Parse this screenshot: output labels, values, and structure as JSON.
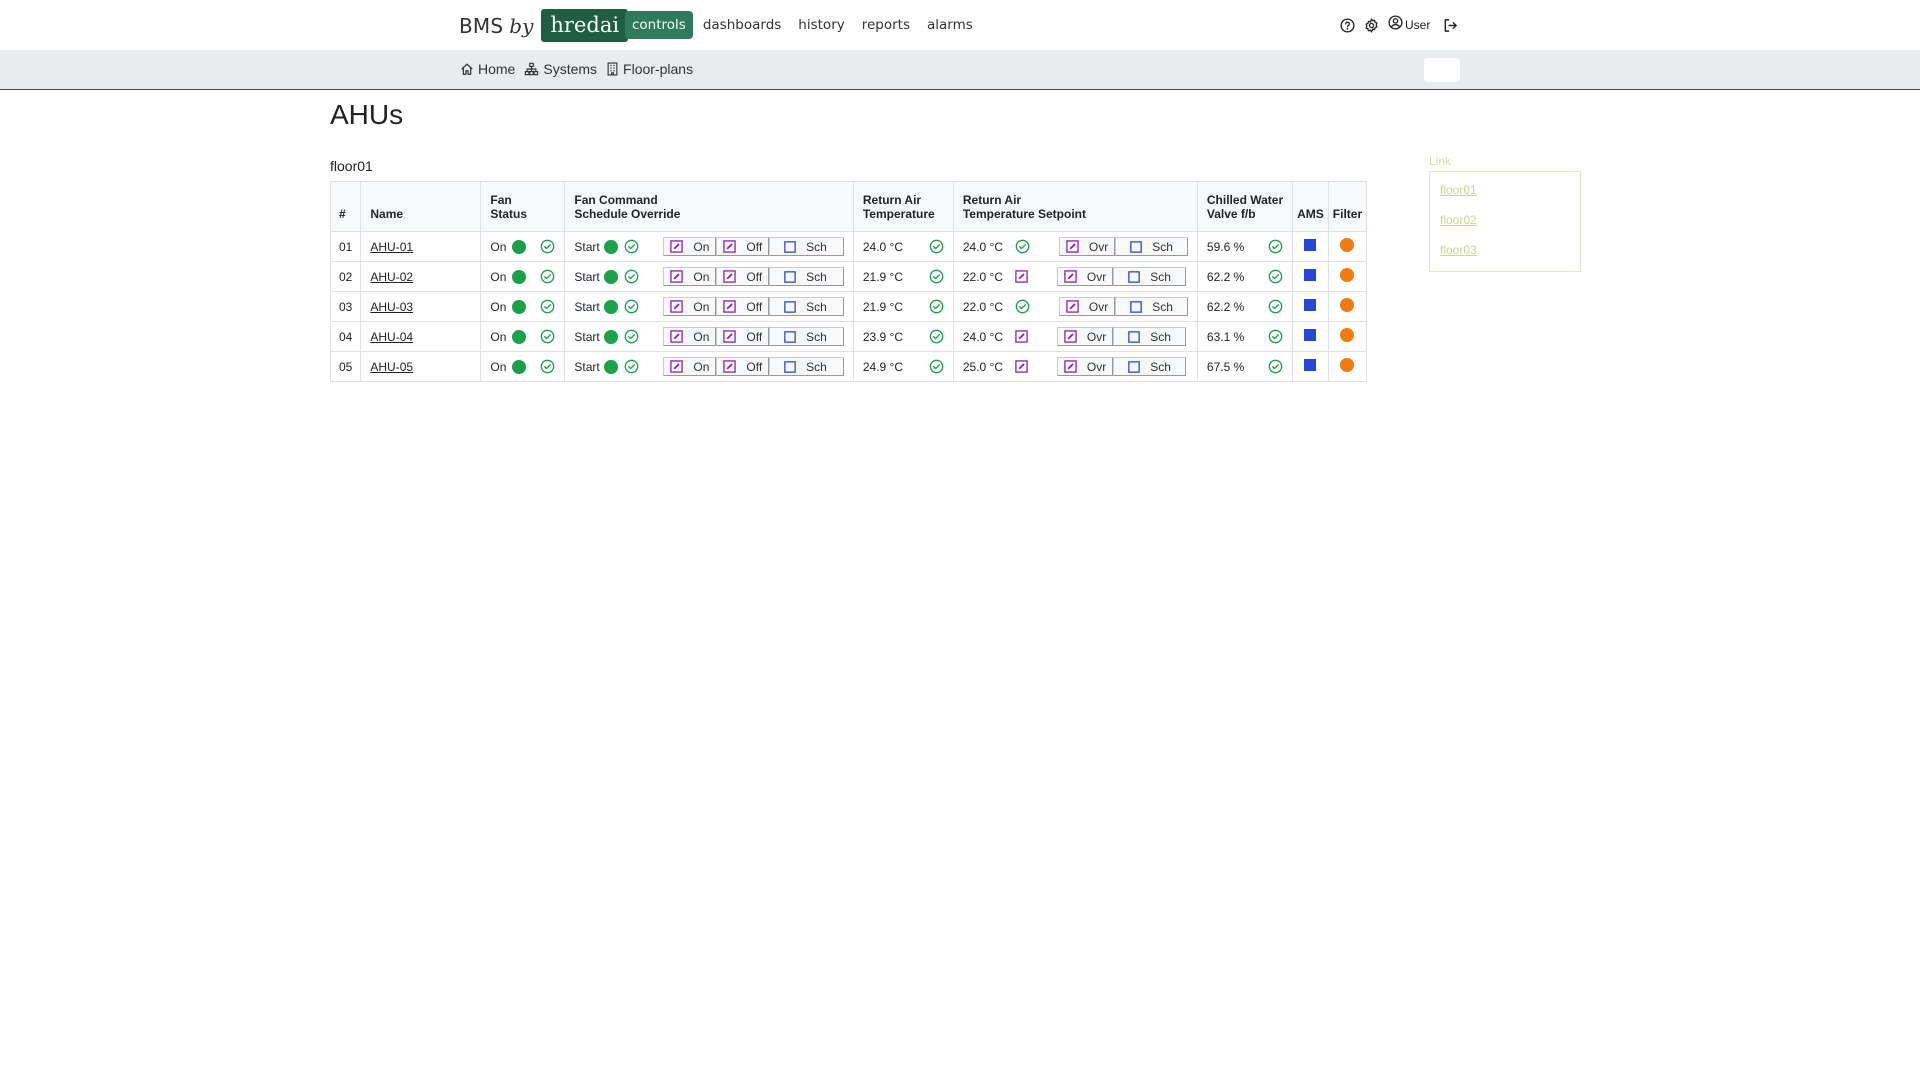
{
  "brand": {
    "bms": "BMS",
    "by": "by",
    "logo": "hredai"
  },
  "nav": {
    "items": [
      {
        "label": "controls",
        "active": true
      },
      {
        "label": "dashboards",
        "active": false
      },
      {
        "label": "history",
        "active": false
      },
      {
        "label": "reports",
        "active": false
      },
      {
        "label": "alarms",
        "active": false
      }
    ],
    "user_label": "User",
    "icons": [
      "help-icon",
      "settings-icon",
      "user-circle-icon",
      "logout-icon"
    ]
  },
  "subnav": {
    "items": [
      {
        "label": "Home",
        "icon": "home-icon"
      },
      {
        "label": "Systems",
        "icon": "sitemap-icon"
      },
      {
        "label": "Floor-plans",
        "icon": "building-icon"
      }
    ]
  },
  "page": {
    "title": "AHUs",
    "section": "floor01"
  },
  "table": {
    "headers": {
      "num": "#",
      "name": "Name",
      "fan_status_1": "Fan",
      "fan_status_2": "Status",
      "fan_cmd_1": "Fan Command",
      "fan_cmd_2": "Schedule Override",
      "rat_1": "Return Air",
      "rat_2": "Temperature",
      "rats_1": "Return Air",
      "rats_2": "Temperature Setpoint",
      "chw_1": "Chilled Water",
      "chw_2": "Valve f/b",
      "ams": "AMS",
      "filter": "Filter"
    },
    "buttons": {
      "on": "On",
      "off": "Off",
      "sch": "Sch",
      "ovr": "Ovr"
    },
    "rows": [
      {
        "num": "01",
        "name": "AHU-01",
        "fan_status": "On",
        "fan_cmd": "Start",
        "rat": "24.0 °C",
        "rats": "24.0 °C",
        "rats_overridden": false,
        "chw": "59.6 %"
      },
      {
        "num": "02",
        "name": "AHU-02",
        "fan_status": "On",
        "fan_cmd": "Start",
        "rat": "21.9 °C",
        "rats": "22.0 °C",
        "rats_overridden": true,
        "chw": "62.2 %"
      },
      {
        "num": "03",
        "name": "AHU-03",
        "fan_status": "On",
        "fan_cmd": "Start",
        "rat": "21.9 °C",
        "rats": "22.0 °C",
        "rats_overridden": false,
        "chw": "62.2 %"
      },
      {
        "num": "04",
        "name": "AHU-04",
        "fan_status": "On",
        "fan_cmd": "Start",
        "rat": "23.9 °C",
        "rats": "24.0 °C",
        "rats_overridden": true,
        "chw": "63.1 %"
      },
      {
        "num": "05",
        "name": "AHU-05",
        "fan_status": "On",
        "fan_cmd": "Start",
        "rat": "24.9 °C",
        "rats": "25.0 °C",
        "rats_overridden": true,
        "chw": "67.5 %"
      }
    ]
  },
  "link_panel": {
    "label": "Link",
    "links": [
      "floor01",
      "floor02",
      "floor03"
    ]
  },
  "colors": {
    "brand_green": "#1f5e45",
    "nav_active": "#2f7a5e",
    "status_green": "#1aa14a",
    "edit_purple": "#8a1fb0",
    "sch_blue": "#2646d6",
    "filter_orange": "#f17b10",
    "link_panel": "#c8d891"
  }
}
